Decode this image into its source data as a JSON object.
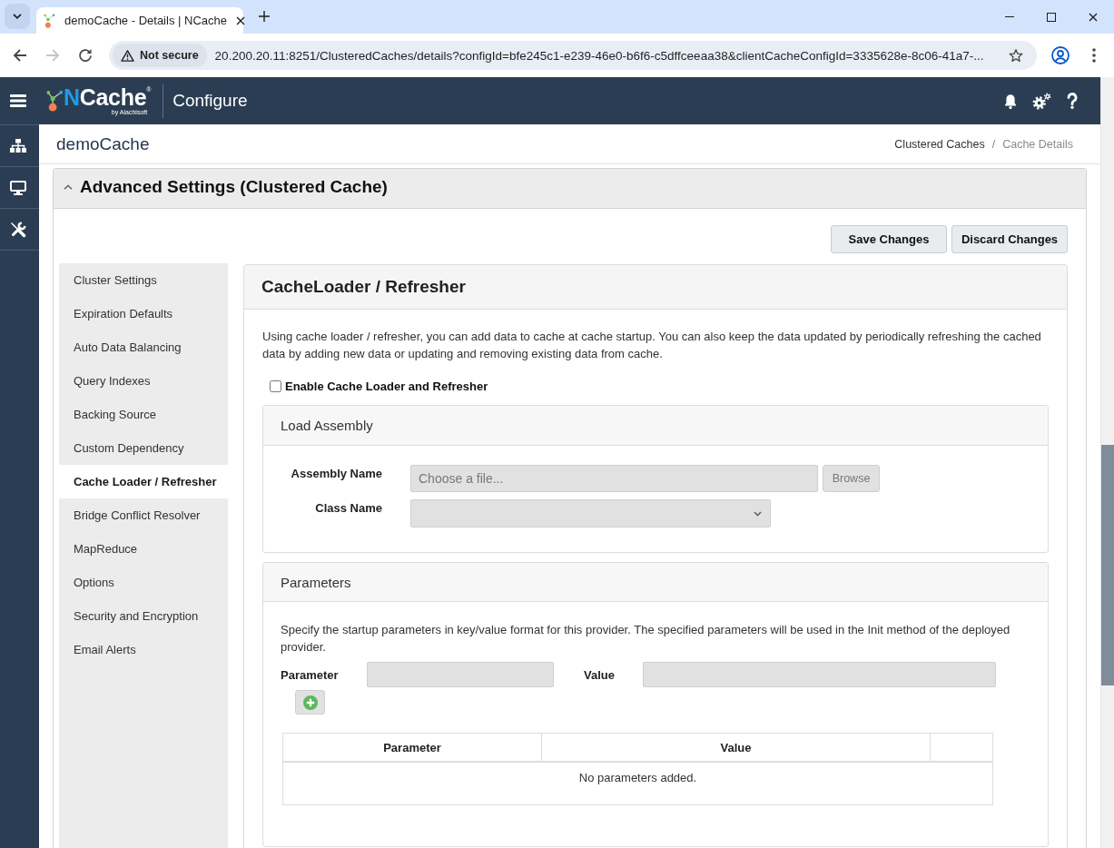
{
  "browser": {
    "tab_title": "demoCache - Details | NCache",
    "back": {
      "disabled": false
    },
    "forward": {
      "disabled": true
    },
    "security_label": "Not secure",
    "url": "20.200.20.11:8251/ClusteredCaches/details?configId=bfe245c1-e239-46e0-b6f6-c5dffceeaa38&clientCacheConfigId=3335628e-8c06-41a7-..."
  },
  "app_header": {
    "logo": "NCache$^{®}$",
    "logo_byline": "by Alachisoft",
    "section": "Configure"
  },
  "page_title": "demoCache",
  "breadcrumb": {
    "separator": "/",
    "items": [
      {
        "label": "Clustered Caches",
        "current": false
      },
      {
        "label": "Cache Details",
        "current": true
      }
    ]
  },
  "settings_panel": {
    "title": "Advanced Settings (Clustered Cache)",
    "expanded": true,
    "buttons": [
      "Save Changes",
      "Discard Changes"
    ]
  },
  "nav": [
    {
      "label": "Cluster Settings",
      "selected": false
    },
    {
      "label": "Expiration Defaults",
      "selected": false
    },
    {
      "label": "Auto Data Balancing",
      "selected": false
    },
    {
      "label": "Query Indexes",
      "selected": false
    },
    {
      "label": "Backing Source",
      "selected": false
    },
    {
      "label": "Custom Dependency",
      "selected": false
    },
    {
      "label": "Cache Loader / Refresher",
      "selected": true
    },
    {
      "label": "Bridge Conflict Resolver",
      "selected": false
    },
    {
      "label": "MapReduce",
      "selected": false
    },
    {
      "label": "Options",
      "selected": false
    },
    {
      "label": "Security and Encryption",
      "selected": false
    },
    {
      "label": "Email Alerts",
      "selected": false
    }
  ],
  "content": {
    "title": "CacheLoader / Refresher",
    "description": "Using cache loader / refresher, you can add data to cache at cache startup. You can also keep the data updated by periodically refreshing the cached data by adding new data or updating and removing existing data from cache.",
    "enable_checkbox": {
      "label": "Enable Cache Loader and Refresher",
      "checked": false
    },
    "load_assembly": {
      "title": "Load Assembly",
      "assembly_name": {
        "label": "Assembly Name",
        "placeholder": "Choose a file...",
        "button": "Browse"
      },
      "class_name": {
        "label": "Class Name"
      }
    },
    "parameters": {
      "title": "Parameters",
      "description": "Specify the startup parameters in key/value format for this provider. The specified parameters will be used in the Init method of the deployed provider.",
      "parameter_field": {
        "label": "Parameter"
      },
      "value_field": {
        "label": "Value"
      },
      "table": {
        "columns": [
          "Parameter",
          "Value"
        ],
        "empty_message": "No parameters added."
      }
    }
  }
}
